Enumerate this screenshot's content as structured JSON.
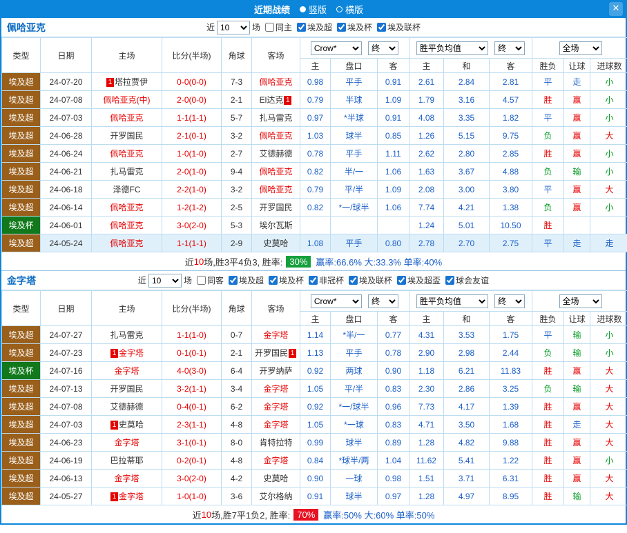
{
  "colors": {
    "titlebar": "#0b86db",
    "league_super": "#9a5f1b",
    "league_cup": "#11791c",
    "win": "#e60000",
    "draw": "#1a5fc8",
    "lose": "#009a1f",
    "rate_green": "#16a03c",
    "rate_red": "#e81123"
  },
  "titlebar": {
    "title": "近期战绩",
    "portrait": "竖版",
    "landscape": "横版",
    "close": "✕"
  },
  "labels": {
    "near": "近",
    "count": "10",
    "games": "场"
  },
  "table_header": {
    "cols": [
      "类型",
      "日期",
      "主场",
      "比分(半场)",
      "角球",
      "客场"
    ],
    "company": "Crow*",
    "stage": "终",
    "avg": "胜平负均值",
    "fulltime": "全场",
    "sub": [
      "主",
      "盘口",
      "客",
      "主",
      "和",
      "客",
      "胜负",
      "让球",
      "进球数"
    ]
  },
  "sections": [
    {
      "team": "佩哈亚克",
      "same": "同主",
      "leagues": [
        "埃及超",
        "埃及杯",
        "埃及联杯"
      ],
      "rows": [
        {
          "t": "埃及超",
          "tc": "s",
          "d": "24-07-20",
          "hb": "1",
          "h": "塔拉贾伊",
          "hr": 0,
          "s": "0-0(0-0)",
          "cr": "7-3",
          "a": "佩哈亚克",
          "ab": "",
          "ar": 1,
          "o1": "0.98",
          "hd": "平手",
          "o2": "0.91",
          "m1": "2.61",
          "m2": "2.84",
          "m3": "2.81",
          "r1": "平",
          "c1": "b",
          "r2": "走",
          "c2": "b",
          "r3": "小",
          "c3": "g",
          "hl": 0
        },
        {
          "t": "埃及超",
          "tc": "s",
          "d": "24-07-08",
          "hb": "",
          "h": "佩哈亚克(中)",
          "hr": 1,
          "s": "2-0(0-0)",
          "cr": "2-1",
          "a": "El达克",
          "ab": "1",
          "ar": 0,
          "o1": "0.79",
          "hd": "半球",
          "o2": "1.09",
          "m1": "1.79",
          "m2": "3.16",
          "m3": "4.57",
          "r1": "胜",
          "c1": "r",
          "r2": "赢",
          "c2": "r",
          "r3": "小",
          "c3": "g",
          "hl": 0
        },
        {
          "t": "埃及超",
          "tc": "s",
          "d": "24-07-03",
          "hb": "",
          "h": "佩哈亚克",
          "hr": 1,
          "s": "1-1(1-1)",
          "cr": "5-7",
          "a": "扎马雷克",
          "ab": "",
          "ar": 0,
          "o1": "0.97",
          "hd": "*半球",
          "o2": "0.91",
          "m1": "4.08",
          "m2": "3.35",
          "m3": "1.82",
          "r1": "平",
          "c1": "b",
          "r2": "赢",
          "c2": "r",
          "r3": "小",
          "c3": "g",
          "hl": 0
        },
        {
          "t": "埃及超",
          "tc": "s",
          "d": "24-06-28",
          "hb": "",
          "h": "开罗国民",
          "hr": 0,
          "s": "2-1(0-1)",
          "cr": "3-2",
          "a": "佩哈亚克",
          "ab": "",
          "ar": 1,
          "o1": "1.03",
          "hd": "球半",
          "o2": "0.85",
          "m1": "1.26",
          "m2": "5.15",
          "m3": "9.75",
          "r1": "负",
          "c1": "g",
          "r2": "赢",
          "c2": "r",
          "r3": "大",
          "c3": "r",
          "hl": 0
        },
        {
          "t": "埃及超",
          "tc": "s",
          "d": "24-06-24",
          "hb": "",
          "h": "佩哈亚克",
          "hr": 1,
          "s": "1-0(1-0)",
          "cr": "2-7",
          "a": "艾德赫德",
          "ab": "",
          "ar": 0,
          "o1": "0.78",
          "hd": "平手",
          "o2": "1.11",
          "m1": "2.62",
          "m2": "2.80",
          "m3": "2.85",
          "r1": "胜",
          "c1": "r",
          "r2": "赢",
          "c2": "r",
          "r3": "小",
          "c3": "g",
          "hl": 0
        },
        {
          "t": "埃及超",
          "tc": "s",
          "d": "24-06-21",
          "hb": "",
          "h": "扎马雷克",
          "hr": 0,
          "s": "2-0(1-0)",
          "cr": "9-4",
          "a": "佩哈亚克",
          "ab": "",
          "ar": 1,
          "o1": "0.82",
          "hd": "半/一",
          "o2": "1.06",
          "m1": "1.63",
          "m2": "3.67",
          "m3": "4.88",
          "r1": "负",
          "c1": "g",
          "r2": "输",
          "c2": "g",
          "r3": "小",
          "c3": "g",
          "hl": 0
        },
        {
          "t": "埃及超",
          "tc": "s",
          "d": "24-06-18",
          "hb": "",
          "h": "泽德FC",
          "hr": 0,
          "s": "2-2(1-0)",
          "cr": "3-2",
          "a": "佩哈亚克",
          "ab": "",
          "ar": 1,
          "o1": "0.79",
          "hd": "平/半",
          "o2": "1.09",
          "m1": "2.08",
          "m2": "3.00",
          "m3": "3.80",
          "r1": "平",
          "c1": "b",
          "r2": "赢",
          "c2": "r",
          "r3": "大",
          "c3": "r",
          "hl": 0
        },
        {
          "t": "埃及超",
          "tc": "s",
          "d": "24-06-14",
          "hb": "",
          "h": "佩哈亚克",
          "hr": 1,
          "s": "1-2(1-2)",
          "cr": "2-5",
          "a": "开罗国民",
          "ab": "",
          "ar": 0,
          "o1": "0.82",
          "hd": "*一/球半",
          "o2": "1.06",
          "m1": "7.74",
          "m2": "4.21",
          "m3": "1.38",
          "r1": "负",
          "c1": "g",
          "r2": "赢",
          "c2": "r",
          "r3": "小",
          "c3": "g",
          "hl": 0
        },
        {
          "t": "埃及杯",
          "tc": "c",
          "d": "24-06-01",
          "hb": "",
          "h": "佩哈亚克",
          "hr": 1,
          "s": "3-0(2-0)",
          "cr": "5-3",
          "a": "埃尔瓦斯",
          "ab": "",
          "ar": 0,
          "o1": "",
          "hd": "",
          "o2": "",
          "m1": "1.24",
          "m2": "5.01",
          "m3": "10.50",
          "r1": "胜",
          "c1": "r",
          "r2": "",
          "c2": "",
          "r3": "",
          "c3": "",
          "hl": 0
        },
        {
          "t": "埃及超",
          "tc": "s",
          "d": "24-05-24",
          "hb": "",
          "h": "佩哈亚克",
          "hr": 1,
          "s": "1-1(1-1)",
          "cr": "2-9",
          "a": "史莫哈",
          "ab": "",
          "ar": 0,
          "o1": "1.08",
          "hd": "平手",
          "o2": "0.80",
          "m1": "2.78",
          "m2": "2.70",
          "m3": "2.75",
          "r1": "平",
          "c1": "b",
          "r2": "走",
          "c2": "b",
          "r3": "走",
          "c3": "b",
          "hl": 1
        }
      ],
      "summary": {
        "pre": "近",
        "num": "10",
        "mid": "场,胜3平4负3, 胜率:",
        "rate": "30%",
        "cls": "green",
        "tail": "赢率:66.6% 大:33.3% 单率:40%"
      }
    },
    {
      "team": "金字塔",
      "same": "同客",
      "leagues": [
        "埃及超",
        "埃及杯",
        "非冠杯",
        "埃及联杯",
        "埃及超盃",
        "球会友谊"
      ],
      "rows": [
        {
          "t": "埃及超",
          "tc": "s",
          "d": "24-07-27",
          "hb": "",
          "h": "扎马雷克",
          "hr": 0,
          "s": "1-1(1-0)",
          "cr": "0-7",
          "a": "金字塔",
          "ab": "",
          "ar": 1,
          "o1": "1.14",
          "hd": "*半/一",
          "o2": "0.77",
          "m1": "4.31",
          "m2": "3.53",
          "m3": "1.75",
          "r1": "平",
          "c1": "b",
          "r2": "输",
          "c2": "g",
          "r3": "小",
          "c3": "g",
          "hl": 0
        },
        {
          "t": "埃及超",
          "tc": "s",
          "d": "24-07-23",
          "hb": "1",
          "h": "金字塔",
          "hr": 1,
          "s": "0-1(0-1)",
          "cr": "2-1",
          "a": "开罗国民",
          "ab": "1",
          "ar": 0,
          "o1": "1.13",
          "hd": "平手",
          "o2": "0.78",
          "m1": "2.90",
          "m2": "2.98",
          "m3": "2.44",
          "r1": "负",
          "c1": "g",
          "r2": "输",
          "c2": "g",
          "r3": "小",
          "c3": "g",
          "hl": 0
        },
        {
          "t": "埃及杯",
          "tc": "c",
          "d": "24-07-16",
          "hb": "",
          "h": "金字塔",
          "hr": 1,
          "s": "4-0(3-0)",
          "cr": "6-4",
          "a": "开罗纳萨",
          "ab": "",
          "ar": 0,
          "o1": "0.92",
          "hd": "两球",
          "o2": "0.90",
          "m1": "1.18",
          "m2": "6.21",
          "m3": "11.83",
          "r1": "胜",
          "c1": "r",
          "r2": "赢",
          "c2": "r",
          "r3": "大",
          "c3": "r",
          "hl": 0
        },
        {
          "t": "埃及超",
          "tc": "s",
          "d": "24-07-13",
          "hb": "",
          "h": "开罗国民",
          "hr": 0,
          "s": "3-2(1-1)",
          "cr": "3-4",
          "a": "金字塔",
          "ab": "",
          "ar": 1,
          "o1": "1.05",
          "hd": "平/半",
          "o2": "0.83",
          "m1": "2.30",
          "m2": "2.86",
          "m3": "3.25",
          "r1": "负",
          "c1": "g",
          "r2": "输",
          "c2": "g",
          "r3": "大",
          "c3": "r",
          "hl": 0
        },
        {
          "t": "埃及超",
          "tc": "s",
          "d": "24-07-08",
          "hb": "",
          "h": "艾德赫德",
          "hr": 0,
          "s": "0-4(0-1)",
          "cr": "6-2",
          "a": "金字塔",
          "ab": "",
          "ar": 1,
          "o1": "0.92",
          "hd": "*一/球半",
          "o2": "0.96",
          "m1": "7.73",
          "m2": "4.17",
          "m3": "1.39",
          "r1": "胜",
          "c1": "r",
          "r2": "赢",
          "c2": "r",
          "r3": "大",
          "c3": "r",
          "hl": 0
        },
        {
          "t": "埃及超",
          "tc": "s",
          "d": "24-07-03",
          "hb": "1",
          "h": "史莫哈",
          "hr": 0,
          "s": "2-3(1-1)",
          "cr": "4-8",
          "a": "金字塔",
          "ab": "",
          "ar": 1,
          "o1": "1.05",
          "hd": "*一球",
          "o2": "0.83",
          "m1": "4.71",
          "m2": "3.50",
          "m3": "1.68",
          "r1": "胜",
          "c1": "r",
          "r2": "走",
          "c2": "b",
          "r3": "大",
          "c3": "r",
          "hl": 0
        },
        {
          "t": "埃及超",
          "tc": "s",
          "d": "24-06-23",
          "hb": "",
          "h": "金字塔",
          "hr": 1,
          "s": "3-1(0-1)",
          "cr": "8-0",
          "a": "肯特拉特",
          "ab": "",
          "ar": 0,
          "o1": "0.99",
          "hd": "球半",
          "o2": "0.89",
          "m1": "1.28",
          "m2": "4.82",
          "m3": "9.88",
          "r1": "胜",
          "c1": "r",
          "r2": "赢",
          "c2": "r",
          "r3": "大",
          "c3": "r",
          "hl": 0
        },
        {
          "t": "埃及超",
          "tc": "s",
          "d": "24-06-19",
          "hb": "",
          "h": "巴拉蒂耶",
          "hr": 0,
          "s": "0-2(0-1)",
          "cr": "4-8",
          "a": "金字塔",
          "ab": "",
          "ar": 1,
          "o1": "0.84",
          "hd": "*球半/两",
          "o2": "1.04",
          "m1": "11.62",
          "m2": "5.41",
          "m3": "1.22",
          "r1": "胜",
          "c1": "r",
          "r2": "赢",
          "c2": "r",
          "r3": "小",
          "c3": "g",
          "hl": 0
        },
        {
          "t": "埃及超",
          "tc": "s",
          "d": "24-06-13",
          "hb": "",
          "h": "金字塔",
          "hr": 1,
          "s": "3-0(2-0)",
          "cr": "4-2",
          "a": "史莫哈",
          "ab": "",
          "ar": 0,
          "o1": "0.90",
          "hd": "一球",
          "o2": "0.98",
          "m1": "1.51",
          "m2": "3.71",
          "m3": "6.31",
          "r1": "胜",
          "c1": "r",
          "r2": "赢",
          "c2": "r",
          "r3": "大",
          "c3": "r",
          "hl": 0
        },
        {
          "t": "埃及超",
          "tc": "s",
          "d": "24-05-27",
          "hb": "1",
          "h": "金字塔",
          "hr": 1,
          "s": "1-0(1-0)",
          "cr": "3-6",
          "a": "艾尔格纳",
          "ab": "",
          "ar": 0,
          "o1": "0.91",
          "hd": "球半",
          "o2": "0.97",
          "m1": "1.28",
          "m2": "4.97",
          "m3": "8.95",
          "r1": "胜",
          "c1": "r",
          "r2": "输",
          "c2": "g",
          "r3": "大",
          "c3": "r",
          "hl": 0
        }
      ],
      "summary": {
        "pre": "近",
        "num": "10",
        "mid": "场,胜7平1负2, 胜率:",
        "rate": "70%",
        "cls": "red",
        "tail": "赢率:50% 大:60% 单率:50%"
      }
    }
  ]
}
